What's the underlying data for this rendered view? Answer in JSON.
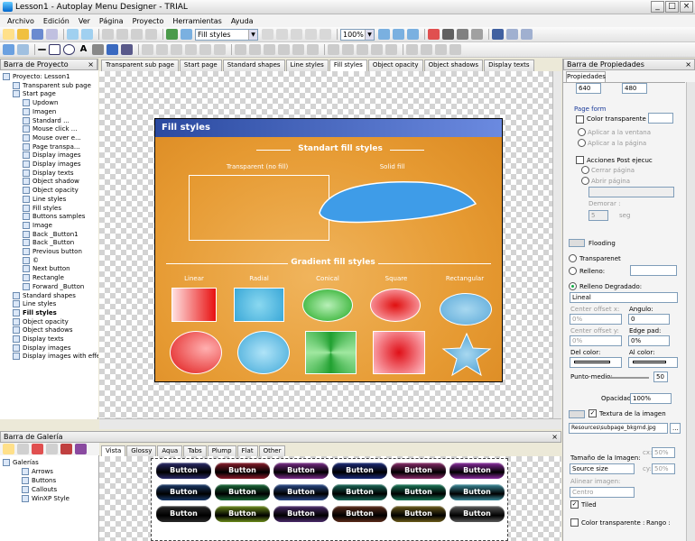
{
  "window": {
    "title": "Lesson1 - Autoplay Menu Designer - TRIAL",
    "controls": [
      "_",
      "□",
      "×"
    ]
  },
  "menu": [
    "Archivo",
    "Edición",
    "Ver",
    "Página",
    "Proyecto",
    "Herramientas",
    "Ayuda"
  ],
  "toolbar": {
    "page_combo": "Fill styles",
    "zoom": "100%"
  },
  "project_panel": {
    "title": "Barra de Proyecto",
    "nodes": [
      {
        "label": "Proyecto: Lesson1",
        "level": 0,
        "bold": false
      },
      {
        "label": "Transparent sub page",
        "level": 1,
        "bold": false
      },
      {
        "label": "Start page",
        "level": 1,
        "bold": false
      },
      {
        "label": "Updown",
        "level": 2,
        "bold": false
      },
      {
        "label": "Imagen",
        "level": 2,
        "bold": false
      },
      {
        "label": "Standard ...",
        "level": 2,
        "bold": false
      },
      {
        "label": "Mouse click ...",
        "level": 2,
        "bold": false
      },
      {
        "label": "Mouse over e...",
        "level": 2,
        "bold": false
      },
      {
        "label": "Page transpa...",
        "level": 2,
        "bold": false
      },
      {
        "label": "Display images",
        "level": 2,
        "bold": false
      },
      {
        "label": "Display images",
        "level": 2,
        "bold": false
      },
      {
        "label": "Display texts",
        "level": 2,
        "bold": false
      },
      {
        "label": "Object shadow",
        "level": 2,
        "bold": false
      },
      {
        "label": "Object opacity",
        "level": 2,
        "bold": false
      },
      {
        "label": "Line styles",
        "level": 2,
        "bold": false
      },
      {
        "label": "Fill styles",
        "level": 2,
        "bold": false
      },
      {
        "label": "Buttons samples",
        "level": 2,
        "bold": false
      },
      {
        "label": "Image",
        "level": 2,
        "bold": false
      },
      {
        "label": "Back _Button1",
        "level": 2,
        "bold": false
      },
      {
        "label": "Back _Button",
        "level": 2,
        "bold": false
      },
      {
        "label": "Previous button",
        "level": 2,
        "bold": false
      },
      {
        "label": "©",
        "level": 2,
        "bold": false
      },
      {
        "label": "Next button",
        "level": 2,
        "bold": false
      },
      {
        "label": "Rectangle",
        "level": 2,
        "bold": false
      },
      {
        "label": "Forward _Button",
        "level": 2,
        "bold": false
      },
      {
        "label": "Standard shapes",
        "level": 1,
        "bold": false
      },
      {
        "label": "Line styles",
        "level": 1,
        "bold": false
      },
      {
        "label": "Fill styles",
        "level": 1,
        "bold": true
      },
      {
        "label": "Object opacity",
        "level": 1,
        "bold": false
      },
      {
        "label": "Object shadows",
        "level": 1,
        "bold": false
      },
      {
        "label": "Display texts",
        "level": 1,
        "bold": false
      },
      {
        "label": "Display images",
        "level": 1,
        "bold": false
      },
      {
        "label": "Display images with effects",
        "level": 1,
        "bold": false
      }
    ]
  },
  "doc_tabs": [
    "Transparent sub page",
    "Start page",
    "Standard shapes",
    "Line styles",
    "Fill styles",
    "Object opacity",
    "Object shadows",
    "Display texts"
  ],
  "active_doc_tab": 4,
  "page": {
    "title": "Fill styles",
    "standard_heading": "Standart fill styles",
    "transparent_label": "Transparent (no fill)",
    "solid_label": "Solid fill",
    "gradient_heading": "Gradient fill styles",
    "gradient_labels": [
      "Linear",
      "Radial",
      "Conical",
      "Square",
      "Rectangular"
    ]
  },
  "properties": {
    "title": "Barra de Propiedades",
    "tab": "Propiedades",
    "width": "640",
    "height": "480",
    "page_form": "Page form",
    "color_transparente": "Color transparente :",
    "apply_window": "Aplicar a la ventana",
    "apply_page": "Aplicar a la página",
    "post_actions": "Acciones Post ejecuc",
    "close_page": "Cerrar página",
    "open_page": "Abrir página",
    "delay": "Demorar :",
    "delay_value": "5",
    "seg": "seg",
    "flooding": "Flooding",
    "transparent": "Transparenet",
    "relleno": "Relleno:",
    "relleno_degradado": "Relleno Degradado:",
    "gradient_type": "Lineal",
    "center_x": "Center offset x:",
    "center_x_val": "0%",
    "angulo": "Angulo:",
    "angulo_val": "0",
    "center_y": "Center offset y:",
    "center_y_val": "0%",
    "edge_pad": "Edge pad:",
    "edge_pad_val": "0%",
    "del_color": "Del color:",
    "al_color": "Al color:",
    "punto_medio": "Punto-medio:",
    "punto_medio_val": "50",
    "opacidad": "Opacidad:",
    "opacidad_val": "100%",
    "textura": "Textura de la imagen",
    "texture_file": "Resources\\subpage_bkgrnd.jpg",
    "texture_btn": "...",
    "tamano": "Tamaño de la Imagen:",
    "source_size": "Source size",
    "cx": "cx:",
    "cx_val": "50%",
    "cy": "cy:",
    "cy_val": "50%",
    "alinear": "Alinear imagen:",
    "centro": "Centro",
    "tiled": "Tiled",
    "color_transparente2": "Color transparente :",
    "rango": "Rango :"
  },
  "gallery": {
    "title": "Barra de Galería",
    "tree": [
      "Galerías",
      "Arrows",
      "Buttons",
      "Callouts",
      "WinXP Style"
    ],
    "tabs": [
      "Vista",
      "Glossy",
      "Aqua",
      "Tabs",
      "Plump",
      "Flat",
      "Other"
    ],
    "button_label": "Button",
    "rows": [
      [
        "#2a2a6a",
        "#8a1a2a",
        "#7a2a8a",
        "#1a2a7a",
        "#8a2a6a",
        "#8a2aa0"
      ],
      [
        "#1a3a6a",
        "#1a6a3a",
        "#2a4a8a",
        "#1a6a5a",
        "#1a7a5a",
        "#3a8a9a"
      ],
      [
        "#2a2a2a",
        "#6a8a1a",
        "#4a2a6a",
        "#5a2a1a",
        "#6a5a1a",
        "#5a5a5a"
      ]
    ]
  }
}
